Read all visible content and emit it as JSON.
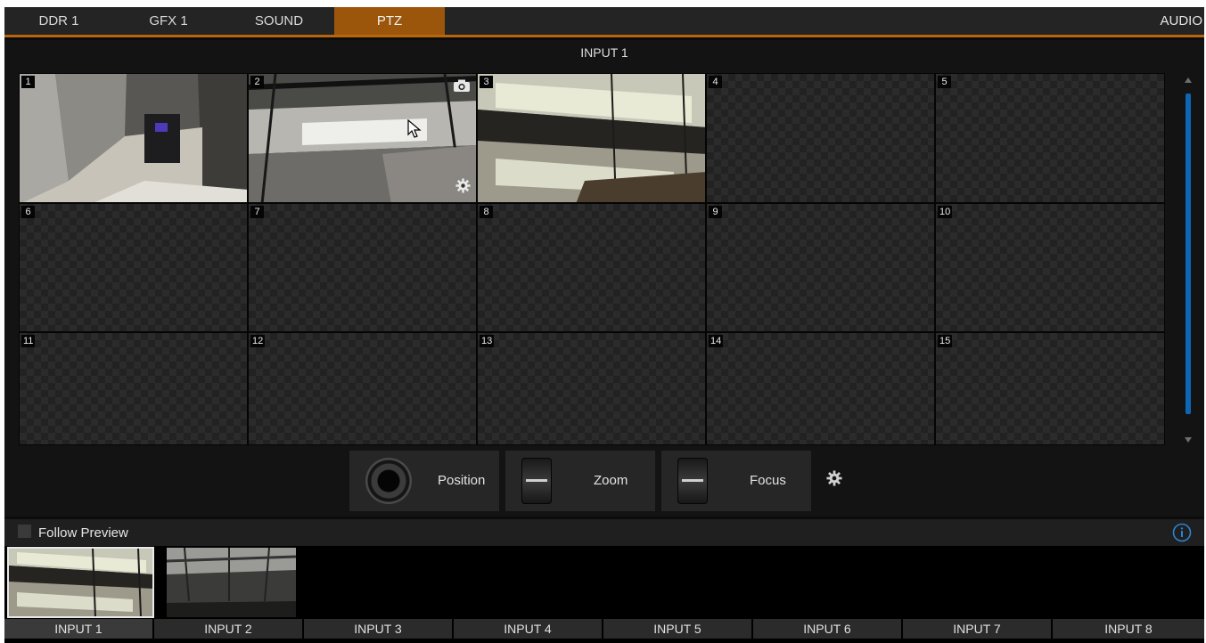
{
  "tabs": [
    {
      "label": "DDR 1",
      "active": false
    },
    {
      "label": "GFX 1",
      "active": false
    },
    {
      "label": "SOUND",
      "active": false
    },
    {
      "label": "PTZ",
      "active": true
    }
  ],
  "tab_right_label": "AUDIO",
  "input_title": "INPUT 1",
  "presets": [
    {
      "num": "1",
      "has_image": true
    },
    {
      "num": "2",
      "has_image": true
    },
    {
      "num": "3",
      "has_image": true
    },
    {
      "num": "4",
      "has_image": false
    },
    {
      "num": "5",
      "has_image": false
    },
    {
      "num": "6",
      "has_image": false
    },
    {
      "num": "7",
      "has_image": false
    },
    {
      "num": "8",
      "has_image": false
    },
    {
      "num": "9",
      "has_image": false
    },
    {
      "num": "10",
      "has_image": false
    },
    {
      "num": "11",
      "has_image": false
    },
    {
      "num": "12",
      "has_image": false
    },
    {
      "num": "13",
      "has_image": false
    },
    {
      "num": "14",
      "has_image": false
    },
    {
      "num": "15",
      "has_image": false
    }
  ],
  "icons": {
    "preset_snapshot": "camera-icon",
    "preset_settings": "gear-icon",
    "pointer": "cursor-icon",
    "info": "info-icon"
  },
  "controls": {
    "position_label": "Position",
    "zoom_label": "Zoom",
    "focus_label": "Focus"
  },
  "follow_preview": {
    "label": "Follow Preview",
    "checked": false
  },
  "inputs": [
    {
      "label": "INPUT 1",
      "selected": true,
      "has_image": true
    },
    {
      "label": "INPUT 2",
      "selected": false,
      "has_image": true
    },
    {
      "label": "INPUT 3",
      "selected": false,
      "has_image": false
    },
    {
      "label": "INPUT 4",
      "selected": false,
      "has_image": false
    },
    {
      "label": "INPUT 5",
      "selected": false,
      "has_image": false
    },
    {
      "label": "INPUT 6",
      "selected": false,
      "has_image": false
    },
    {
      "label": "INPUT 7",
      "selected": false,
      "has_image": false
    },
    {
      "label": "INPUT 8",
      "selected": false,
      "has_image": false
    }
  ],
  "colors": {
    "accent": "#9c560b",
    "scrollbar": "#0d66b4",
    "background": "#131313"
  }
}
